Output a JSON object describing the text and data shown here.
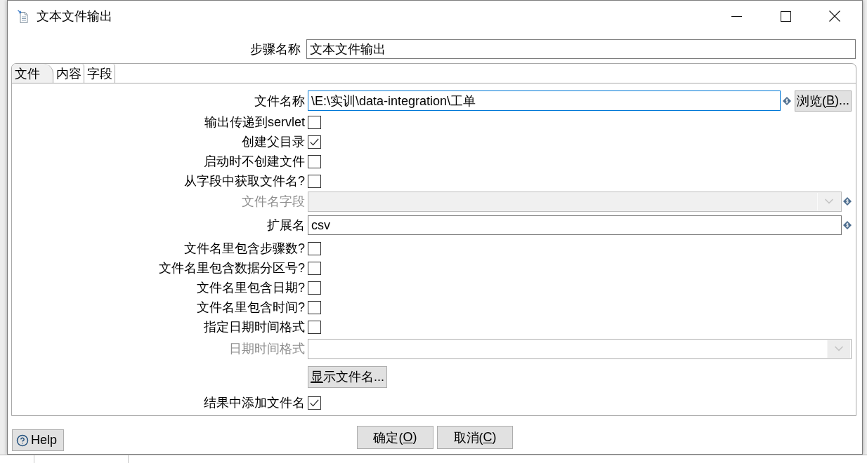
{
  "window": {
    "title": "文本文件输出"
  },
  "step_name": {
    "label": "步骤名称",
    "value": "文本文件输出"
  },
  "tabs": [
    {
      "label": "文件",
      "selected": true
    },
    {
      "label": "内容",
      "selected": false
    },
    {
      "label": "字段",
      "selected": false
    }
  ],
  "fields": [
    {
      "kind": "file",
      "label": "文件名称",
      "value": "\\E:\\实训\\data-integration\\工单",
      "focused": true,
      "variable": true,
      "button": {
        "before": "浏览(",
        "mnemonic": "B",
        "after": ")..."
      }
    },
    {
      "kind": "checkbox",
      "label": "输出传递到servlet",
      "checked": false
    },
    {
      "kind": "checkbox",
      "label": "创建父目录",
      "checked": true
    },
    {
      "kind": "checkbox",
      "label": "启动时不创建文件",
      "checked": false
    },
    {
      "kind": "checkbox",
      "label": "从字段中获取文件名?",
      "checked": false
    },
    {
      "kind": "varcombo",
      "label": "文件名字段",
      "disabled": true,
      "variable": true
    },
    {
      "kind": "text",
      "label": "扩展名",
      "value": "csv",
      "variable": true
    },
    {
      "kind": "checkbox",
      "label": "文件名里包含步骤数?",
      "checked": false
    },
    {
      "kind": "checkbox",
      "label": "文件名里包含数据分区号?",
      "checked": false
    },
    {
      "kind": "checkbox",
      "label": "文件名里包含日期?",
      "checked": false
    },
    {
      "kind": "checkbox",
      "label": "文件名里包含时间?",
      "checked": false
    },
    {
      "kind": "checkbox",
      "label": "指定日期时间格式",
      "checked": false
    },
    {
      "kind": "combo",
      "label": "日期时间格式",
      "disabled": true
    },
    {
      "kind": "button",
      "button": {
        "mnemonic": "显",
        "after": "示文件名..."
      }
    },
    {
      "kind": "checkbox",
      "label": "结果中添加文件名",
      "checked": true
    }
  ],
  "footer": {
    "help": "Help",
    "buttons": [
      {
        "before": "确定(",
        "mnemonic": "O",
        "after": ")"
      },
      {
        "before": "取消(",
        "mnemonic": "C",
        "after": ")"
      }
    ]
  }
}
